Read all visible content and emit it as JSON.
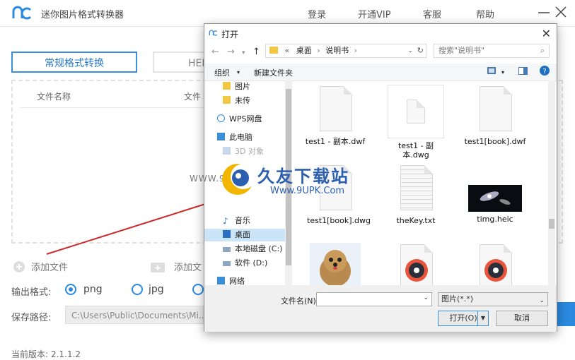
{
  "app": {
    "title": "迷你图片格式转换器",
    "nav": [
      "登录",
      "开通VIP",
      "客服",
      "帮助"
    ],
    "tabs": [
      "常规格式转换",
      "HEI"
    ],
    "columns": [
      "文件名称",
      "文件"
    ],
    "add_file": "添加文件",
    "add_folder": "添加文",
    "output_label": "输出格式:",
    "formats": [
      "png",
      "jpg"
    ],
    "save_label": "保存路径:",
    "save_path": "C:\\Users\\Public\\Documents\\Mi...",
    "version_label": "当前版本:",
    "version": "2.1.1.2"
  },
  "dialog": {
    "title": "打开",
    "breadcrumb": [
      "«",
      "桌面",
      "说明书"
    ],
    "search_placeholder": "搜索\"说明书\"",
    "organize": "组织",
    "new_folder": "新建文件夹",
    "sidebar": [
      {
        "label": "图片",
        "icon": "folder-icon"
      },
      {
        "label": "未传",
        "icon": "folder-icon"
      },
      {
        "label": "WPS网盘",
        "icon": "cloud-icon"
      },
      {
        "label": "此电脑",
        "icon": "computer-icon"
      },
      {
        "label": "3D 对象",
        "icon": "cube-icon"
      },
      {
        "label": "音乐",
        "icon": "music-icon"
      },
      {
        "label": "桌面",
        "icon": "desktop-icon"
      },
      {
        "label": "本地磁盘 (C:)",
        "icon": "drive-icon"
      },
      {
        "label": "软件 (D:)",
        "icon": "drive-icon"
      },
      {
        "label": "网络",
        "icon": "network-icon"
      }
    ],
    "files": [
      {
        "name": "test1 - 副本.dwf",
        "kind": "doc"
      },
      {
        "name": "test1 - 副本.dwg",
        "kind": "doc-small"
      },
      {
        "name": "test1[book].dwf",
        "kind": "doc"
      },
      {
        "name": "test1[book].dwg",
        "kind": "doc"
      },
      {
        "name": "theKey.txt",
        "kind": "text"
      },
      {
        "name": "timg.heic",
        "kind": "galaxy"
      },
      {
        "name": "",
        "kind": "dog"
      },
      {
        "name": "",
        "kind": "media"
      },
      {
        "name": "",
        "kind": "media"
      }
    ],
    "filename_label": "文件名(N):",
    "filetype": "图片(*.*)",
    "open": "打开(O)",
    "cancel": "取消"
  },
  "watermark": {
    "title": "久友下载站",
    "url": "Www.9UPK.Com",
    "www": "WWW.9UPK"
  },
  "colors": {
    "accent": "#2b8ae0",
    "selection": "#cce4f7"
  }
}
